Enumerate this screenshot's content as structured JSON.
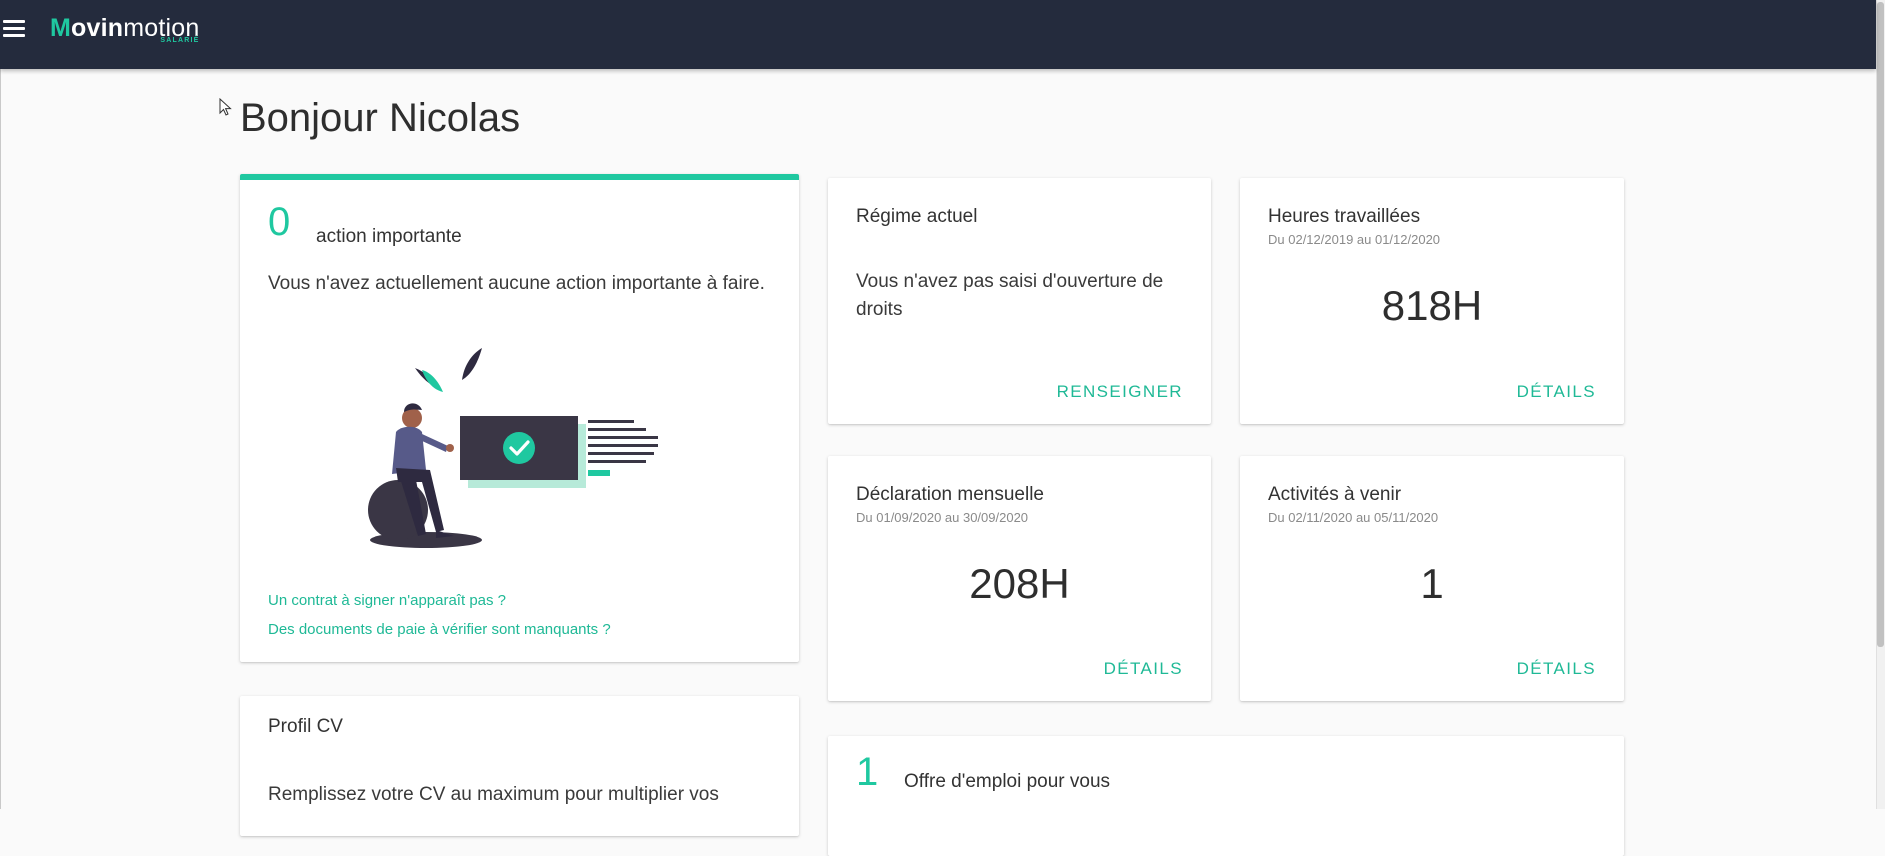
{
  "header": {
    "logo_parts": {
      "m": "M",
      "bold": "ovin",
      "light": "motion"
    },
    "logo_sub": "SALARIÉ"
  },
  "colors": {
    "accent": "#1fc8a0",
    "header_bg": "#242b3d"
  },
  "page": {
    "title": "Bonjour Nicolas"
  },
  "actions_card": {
    "count": "0",
    "label": "action importante",
    "description": "Vous n'avez actuellement aucune action importante à faire.",
    "links": [
      "Un contrat à signer n'apparaît pas ?",
      "Des documents de paie à vérifier sont manquants ?"
    ]
  },
  "regime_card": {
    "title": "Régime actuel",
    "body": "Vous n'avez pas saisi d'ouverture de droits",
    "action": "RENSEIGNER"
  },
  "heures_card": {
    "title": "Heures travaillées",
    "period": "Du 02/12/2019 au 01/12/2020",
    "value": "818H",
    "action": "DÉTAILS"
  },
  "declaration_card": {
    "title": "Déclaration mensuelle",
    "period": "Du 01/09/2020 au 30/09/2020",
    "value": "208H",
    "action": "DÉTAILS"
  },
  "activites_card": {
    "title": "Activités à venir",
    "period": "Du 02/11/2020 au 05/11/2020",
    "value": "1",
    "action": "DÉTAILS"
  },
  "cv_card": {
    "title": "Profil CV",
    "body": "Remplissez votre CV au maximum pour multiplier vos"
  },
  "offre_card": {
    "count": "1",
    "label": "Offre d'emploi pour vous"
  }
}
